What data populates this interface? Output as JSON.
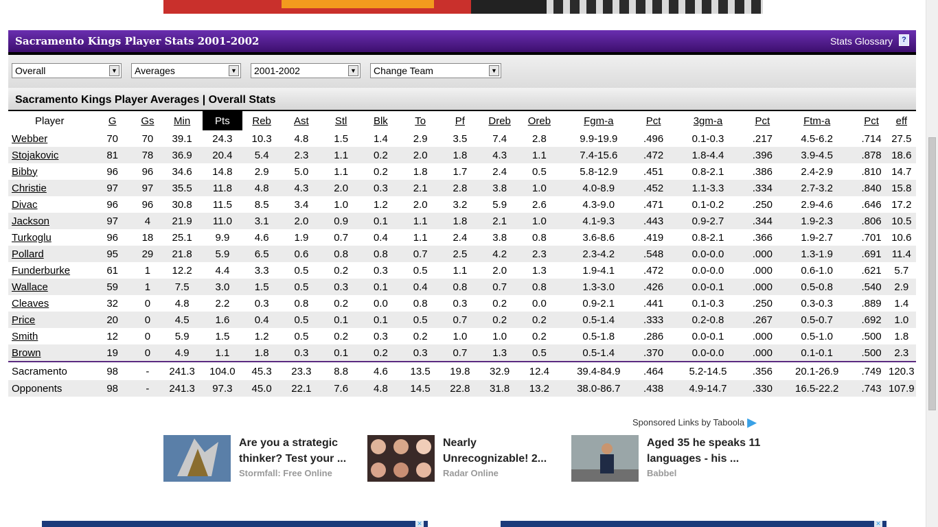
{
  "header": {
    "title": "Sacramento Kings Player Stats 2001-2002",
    "glossary_label": "Stats Glossary",
    "glossary_icon": "?"
  },
  "filters": {
    "scope": "Overall",
    "mode": "Averages",
    "season": "2001-2002",
    "team": "Change Team"
  },
  "subheading": "Sacramento Kings Player Averages | Overall Stats",
  "table": {
    "columns": [
      "Player",
      "G",
      "Gs",
      "Min",
      "Pts",
      "Reb",
      "Ast",
      "Stl",
      "Blk",
      "To",
      "Pf",
      "Dreb",
      "Oreb",
      "Fgm-a",
      "Pct",
      "3gm-a",
      "Pct",
      "Ftm-a",
      "Pct",
      "eff"
    ],
    "active_column": "Pts",
    "players": [
      [
        "Webber",
        "70",
        "70",
        "39.1",
        "24.3",
        "10.3",
        "4.8",
        "1.5",
        "1.4",
        "2.9",
        "3.5",
        "7.4",
        "2.8",
        "9.9-19.9",
        ".496",
        "0.1-0.3",
        ".217",
        "4.5-6.2",
        ".714",
        "27.5"
      ],
      [
        "Stojakovic",
        "81",
        "78",
        "36.9",
        "20.4",
        "5.4",
        "2.3",
        "1.1",
        "0.2",
        "2.0",
        "1.8",
        "4.3",
        "1.1",
        "7.4-15.6",
        ".472",
        "1.8-4.4",
        ".396",
        "3.9-4.5",
        ".878",
        "18.6"
      ],
      [
        "Bibby",
        "96",
        "96",
        "34.6",
        "14.8",
        "2.9",
        "5.0",
        "1.1",
        "0.2",
        "1.8",
        "1.7",
        "2.4",
        "0.5",
        "5.8-12.9",
        ".451",
        "0.8-2.1",
        ".386",
        "2.4-2.9",
        ".810",
        "14.7"
      ],
      [
        "Christie",
        "97",
        "97",
        "35.5",
        "11.8",
        "4.8",
        "4.3",
        "2.0",
        "0.3",
        "2.1",
        "2.8",
        "3.8",
        "1.0",
        "4.0-8.9",
        ".452",
        "1.1-3.3",
        ".334",
        "2.7-3.2",
        ".840",
        "15.8"
      ],
      [
        "Divac",
        "96",
        "96",
        "30.8",
        "11.5",
        "8.5",
        "3.4",
        "1.0",
        "1.2",
        "2.0",
        "3.2",
        "5.9",
        "2.6",
        "4.3-9.0",
        ".471",
        "0.1-0.2",
        ".250",
        "2.9-4.6",
        ".646",
        "17.2"
      ],
      [
        "Jackson",
        "97",
        "4",
        "21.9",
        "11.0",
        "3.1",
        "2.0",
        "0.9",
        "0.1",
        "1.1",
        "1.8",
        "2.1",
        "1.0",
        "4.1-9.3",
        ".443",
        "0.9-2.7",
        ".344",
        "1.9-2.3",
        ".806",
        "10.5"
      ],
      [
        "Turkoglu",
        "96",
        "18",
        "25.1",
        "9.9",
        "4.6",
        "1.9",
        "0.7",
        "0.4",
        "1.1",
        "2.4",
        "3.8",
        "0.8",
        "3.6-8.6",
        ".419",
        "0.8-2.1",
        ".366",
        "1.9-2.7",
        ".701",
        "10.6"
      ],
      [
        "Pollard",
        "95",
        "29",
        "21.8",
        "5.9",
        "6.5",
        "0.6",
        "0.8",
        "0.8",
        "0.7",
        "2.5",
        "4.2",
        "2.3",
        "2.3-4.2",
        ".548",
        "0.0-0.0",
        ".000",
        "1.3-1.9",
        ".691",
        "11.4"
      ],
      [
        "Funderburke",
        "61",
        "1",
        "12.2",
        "4.4",
        "3.3",
        "0.5",
        "0.2",
        "0.3",
        "0.5",
        "1.1",
        "2.0",
        "1.3",
        "1.9-4.1",
        ".472",
        "0.0-0.0",
        ".000",
        "0.6-1.0",
        ".621",
        "5.7"
      ],
      [
        "Wallace",
        "59",
        "1",
        "7.5",
        "3.0",
        "1.5",
        "0.5",
        "0.3",
        "0.1",
        "0.4",
        "0.8",
        "0.7",
        "0.8",
        "1.3-3.0",
        ".426",
        "0.0-0.1",
        ".000",
        "0.5-0.8",
        ".540",
        "2.9"
      ],
      [
        "Cleaves",
        "32",
        "0",
        "4.8",
        "2.2",
        "0.3",
        "0.8",
        "0.2",
        "0.0",
        "0.8",
        "0.3",
        "0.2",
        "0.0",
        "0.9-2.1",
        ".441",
        "0.1-0.3",
        ".250",
        "0.3-0.3",
        ".889",
        "1.4"
      ],
      [
        "Price",
        "20",
        "0",
        "4.5",
        "1.6",
        "0.4",
        "0.5",
        "0.1",
        "0.1",
        "0.5",
        "0.7",
        "0.2",
        "0.2",
        "0.5-1.4",
        ".333",
        "0.2-0.8",
        ".267",
        "0.5-0.7",
        ".692",
        "1.0"
      ],
      [
        "Smith",
        "12",
        "0",
        "5.9",
        "1.5",
        "1.2",
        "0.5",
        "0.2",
        "0.3",
        "0.2",
        "1.0",
        "1.0",
        "0.2",
        "0.5-1.8",
        ".286",
        "0.0-0.1",
        ".000",
        "0.5-1.0",
        ".500",
        "1.8"
      ],
      [
        "Brown",
        "19",
        "0",
        "4.9",
        "1.1",
        "1.8",
        "0.3",
        "0.1",
        "0.2",
        "0.3",
        "0.7",
        "1.3",
        "0.5",
        "0.5-1.4",
        ".370",
        "0.0-0.0",
        ".000",
        "0.1-0.1",
        ".500",
        "2.3"
      ]
    ],
    "totals": [
      [
        "Sacramento",
        "98",
        "-",
        "241.3",
        "104.0",
        "45.3",
        "23.3",
        "8.8",
        "4.6",
        "13.5",
        "19.8",
        "32.9",
        "12.4",
        "39.4-84.9",
        ".464",
        "5.2-14.5",
        ".356",
        "20.1-26.9",
        ".749",
        "120.3"
      ],
      [
        "Opponents",
        "98",
        "-",
        "241.3",
        "97.3",
        "45.0",
        "22.1",
        "7.6",
        "4.8",
        "14.5",
        "22.8",
        "31.8",
        "13.2",
        "38.0-86.7",
        ".438",
        "4.9-14.7",
        ".330",
        "16.5-22.2",
        ".743",
        "107.9"
      ]
    ]
  },
  "sponsored": {
    "label": "Sponsored Links by Taboola",
    "cards": [
      {
        "headline": "Are you a strategic thinker? Test your ...",
        "source": "Stormfall: Free Online"
      },
      {
        "headline": "Nearly Unrecognizable! 2...",
        "source": "Radar Online"
      },
      {
        "headline": "Aged 35 he speaks 11 languages - his ...",
        "source": "Babbel"
      }
    ]
  },
  "colors": {
    "header_top": "#6a2fb0",
    "header_bottom": "#3d0f6e",
    "alt_row": "#ebebeb",
    "active_col_bg": "#000000"
  }
}
